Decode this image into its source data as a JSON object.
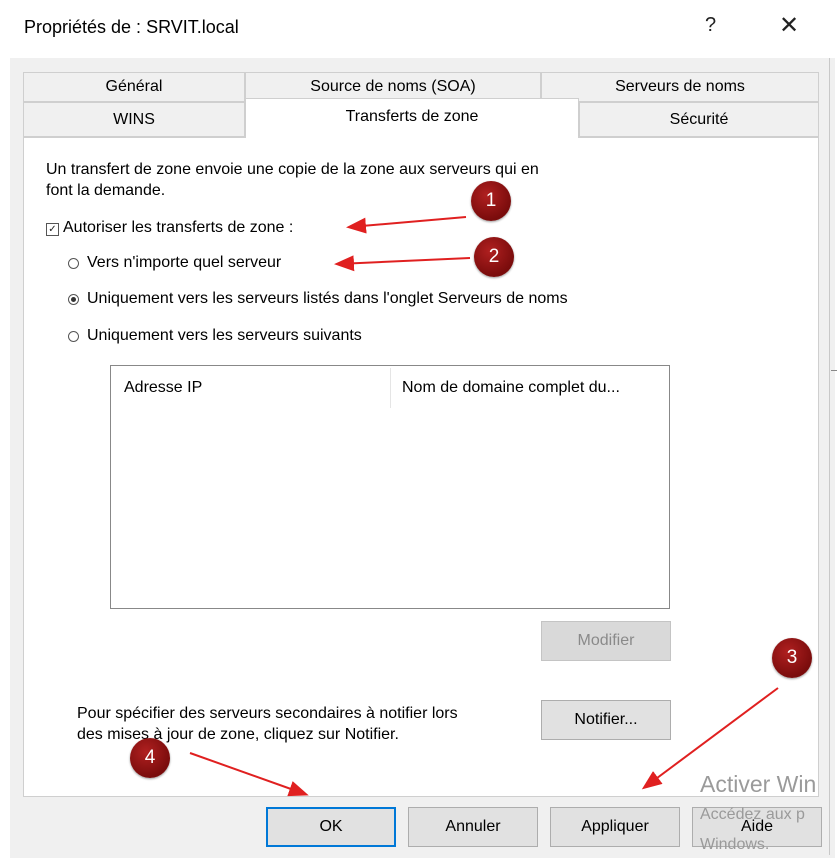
{
  "window": {
    "title": "Propriétés de : SRVIT.local",
    "help_glyph": "?",
    "close_glyph": "✕"
  },
  "tabs": {
    "row1": [
      "Général",
      "Source de noms (SOA)",
      "Serveurs de noms"
    ],
    "row2": [
      "WINS",
      "Transferts de zone",
      "Sécurité"
    ],
    "active": "Transferts de zone"
  },
  "content": {
    "intro_line1": "Un transfert de zone envoie une copie de la zone aux serveurs qui en",
    "intro_line2": "font la demande.",
    "allow_checkbox_label": "Autoriser les transferts de zone :",
    "allow_checked": true,
    "radio_options": [
      {
        "label": "Vers n'importe quel serveur",
        "selected": false
      },
      {
        "label": "Uniquement vers les serveurs listés dans l'onglet Serveurs de noms",
        "selected": true
      },
      {
        "label": "Uniquement vers les serveurs suivants",
        "selected": false
      }
    ],
    "list_columns": [
      "Adresse IP",
      "Nom de domaine complet du..."
    ],
    "modify_button": "Modifier",
    "notify_text_line1": "Pour spécifier des serveurs secondaires à notifier lors",
    "notify_text_line2": "des mises à jour de zone, cliquez sur Notifier.",
    "notify_button": "Notifier..."
  },
  "footer": {
    "ok": "OK",
    "cancel": "Annuler",
    "apply": "Appliquer",
    "help": "Aide"
  },
  "watermark": {
    "line1": "Activer Win",
    "line2": "Accédez aux p",
    "line3": "Windows."
  },
  "annotations": {
    "markers": [
      "1",
      "2",
      "3",
      "4"
    ],
    "marker_color": "#8b0f0f",
    "arrow_color": "#e02020"
  }
}
